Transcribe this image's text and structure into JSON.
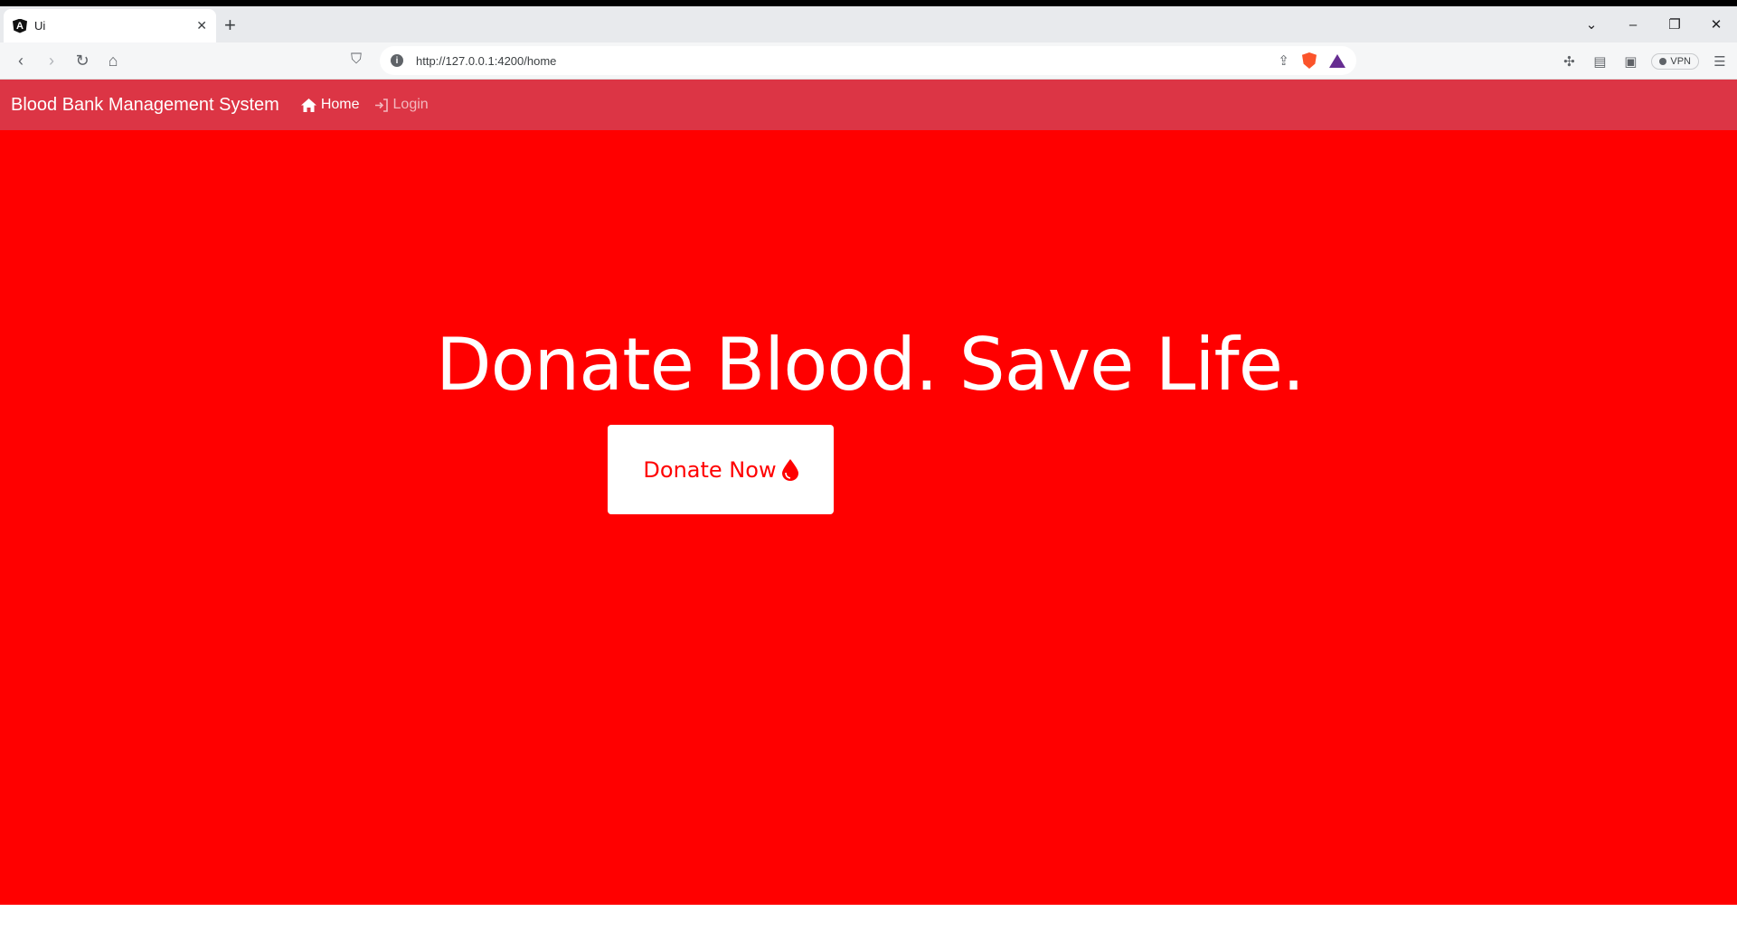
{
  "browser": {
    "tab_title": "Ui",
    "tab_favicon_letter": "A",
    "url": "http://127.0.0.1:4200/home",
    "vpn_label": "VPN"
  },
  "navbar": {
    "brand": "Blood Bank Management System",
    "links": [
      {
        "label": "Home",
        "icon": "home-icon",
        "active": true
      },
      {
        "label": "Login",
        "icon": "login-icon",
        "active": false
      }
    ],
    "color": "#dc3545"
  },
  "hero": {
    "title": "Donate Blood. Save Life.",
    "button_label": "Donate Now",
    "button_icon": "blood-drop-icon",
    "background": "#ff0000"
  }
}
